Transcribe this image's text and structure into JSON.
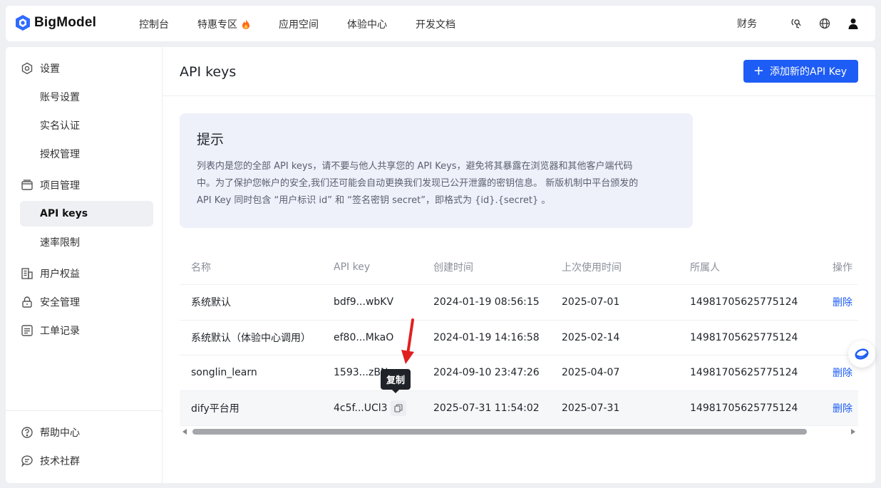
{
  "brand": {
    "name": "BigModel"
  },
  "nav": [
    {
      "label": "控制台"
    },
    {
      "label": "特惠专区"
    },
    {
      "label": "应用空间"
    },
    {
      "label": "体验中心"
    },
    {
      "label": "开发文档"
    }
  ],
  "top_right": {
    "finance": "财务"
  },
  "sidebar": {
    "settings": "设置",
    "account": "账号设置",
    "realname": "实名认证",
    "auth": "授权管理",
    "project": "项目管理",
    "apikeys": "API keys",
    "ratelimit": "速率限制",
    "rights": "用户权益",
    "security": "安全管理",
    "tickets": "工单记录",
    "help": "帮助中心",
    "community": "技术社群"
  },
  "main": {
    "title": "API keys",
    "add_button": "添加新的API Key"
  },
  "tip": {
    "title": "提示",
    "line1": "列表内是您的全部 API keys，请不要与他人共享您的 API Keys，避免将其暴露在浏览器和其他客户端代码",
    "line2": "中。为了保护您帐户的安全,我们还可能会自动更换我们发现已公开泄露的密钥信息。 新版机制中平台颁发的",
    "line3": "API Key 同时包含 “用户标识 id” 和 “签名密钥 secret”，即格式为 {id}.{secret} 。"
  },
  "table": {
    "headers": [
      "名称",
      "API key",
      "创建时间",
      "上次使用时间",
      "所属人",
      "操作"
    ],
    "rows": [
      {
        "name": "系统默认",
        "key": "bdf9...wbKV",
        "created": "2024-01-19 08:56:15",
        "last_used": "2025-07-01",
        "owner": "14981705625775124",
        "action": "删除"
      },
      {
        "name": "系统默认（体验中心调用）",
        "key": "ef80...MkaO",
        "created": "2024-01-19 14:16:58",
        "last_used": "2025-02-14",
        "owner": "14981705625775124",
        "action": ""
      },
      {
        "name": "songlin_learn",
        "key": "1593...zBN",
        "created": "2024-09-10 23:47:26",
        "last_used": "2025-04-07",
        "owner": "14981705625775124",
        "action": "删除"
      },
      {
        "name": "dify平台用",
        "key": "4c5f...UCl3",
        "created": "2025-07-31 11:54:02",
        "last_used": "2025-07-31",
        "owner": "14981705625775124",
        "action": "删除"
      }
    ]
  },
  "tooltip": {
    "copy": "复制"
  },
  "colors": {
    "accent": "#1d5cf5",
    "annotation": "#e02020"
  },
  "icons": [
    "gear-icon",
    "folder-icon",
    "building-icon",
    "lock-icon",
    "list-icon",
    "help-icon",
    "chat-icon",
    "globe-icon",
    "user-icon",
    "voice-icon",
    "copy-icon",
    "fire-icon"
  ]
}
